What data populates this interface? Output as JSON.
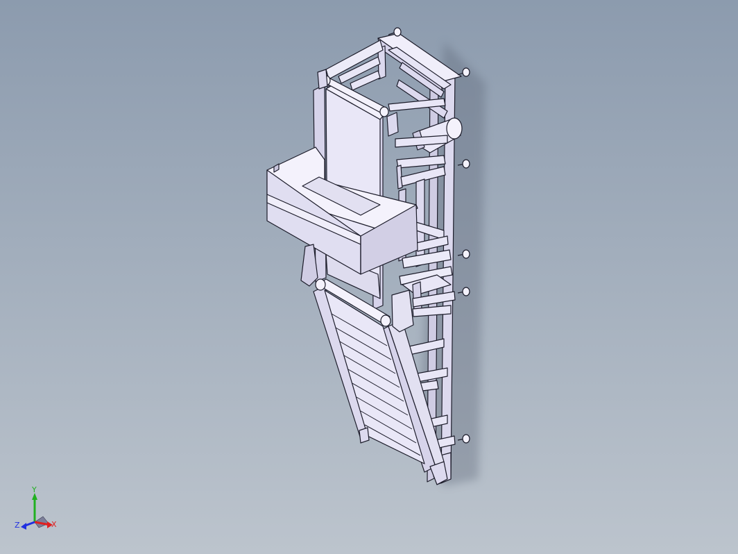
{
  "viewport": {
    "background_top": "#8c9bae",
    "background_bottom": "#bcc4cd"
  },
  "model": {
    "body_color": "#e4e2f2",
    "face_light": "#f2f0fb",
    "face_dark": "#c9c6dd",
    "edge_color": "#1c1c2a"
  },
  "triad": {
    "x_label": "X",
    "y_label": "Y",
    "z_label": "Z",
    "x_color": "#e02020",
    "y_color": "#20b020",
    "z_color": "#2030e0"
  }
}
